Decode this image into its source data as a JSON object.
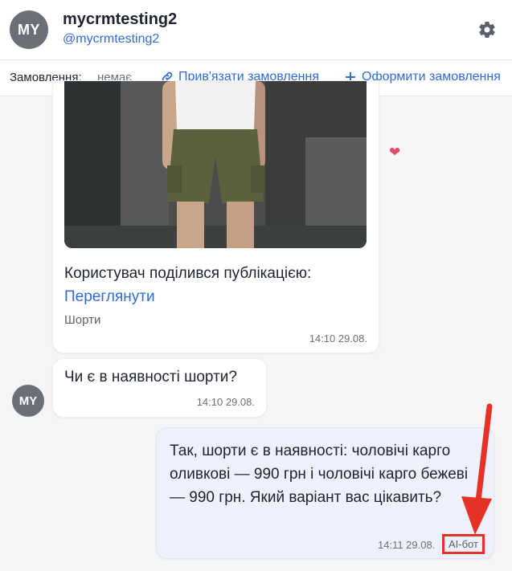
{
  "header": {
    "avatar_initials": "MY",
    "name": "mycrmtesting2",
    "handle": "@mycrmtesting2",
    "settings_icon": "gear-icon"
  },
  "order_bar": {
    "label": "Замовлення:",
    "value": "немає",
    "link_order": "Прив'язати замовлення",
    "create_order": "Оформити замовлення"
  },
  "messages": {
    "post": {
      "shared_text": "Користувач поділився публікацією:",
      "view_link": "Переглянути",
      "caption": "Шорти",
      "time": "14:10 29.08."
    },
    "reaction": "❤",
    "question": {
      "avatar_initials": "MY",
      "text": "Чи є в наявності шорти?",
      "time": "14:10 29.08."
    },
    "answer": {
      "text": "Так, шорти є в наявності: чоловічі карго оливкові — 990 грн і чоловічі карго бежеві — 990 грн. Який варіант вас цікавить?",
      "time": "14:11 29.08.",
      "badge": "AI-бот"
    }
  },
  "colors": {
    "accent": "#2f6bd6",
    "highlight": "#e53126",
    "outgoing_bubble": "#eef1fb"
  }
}
